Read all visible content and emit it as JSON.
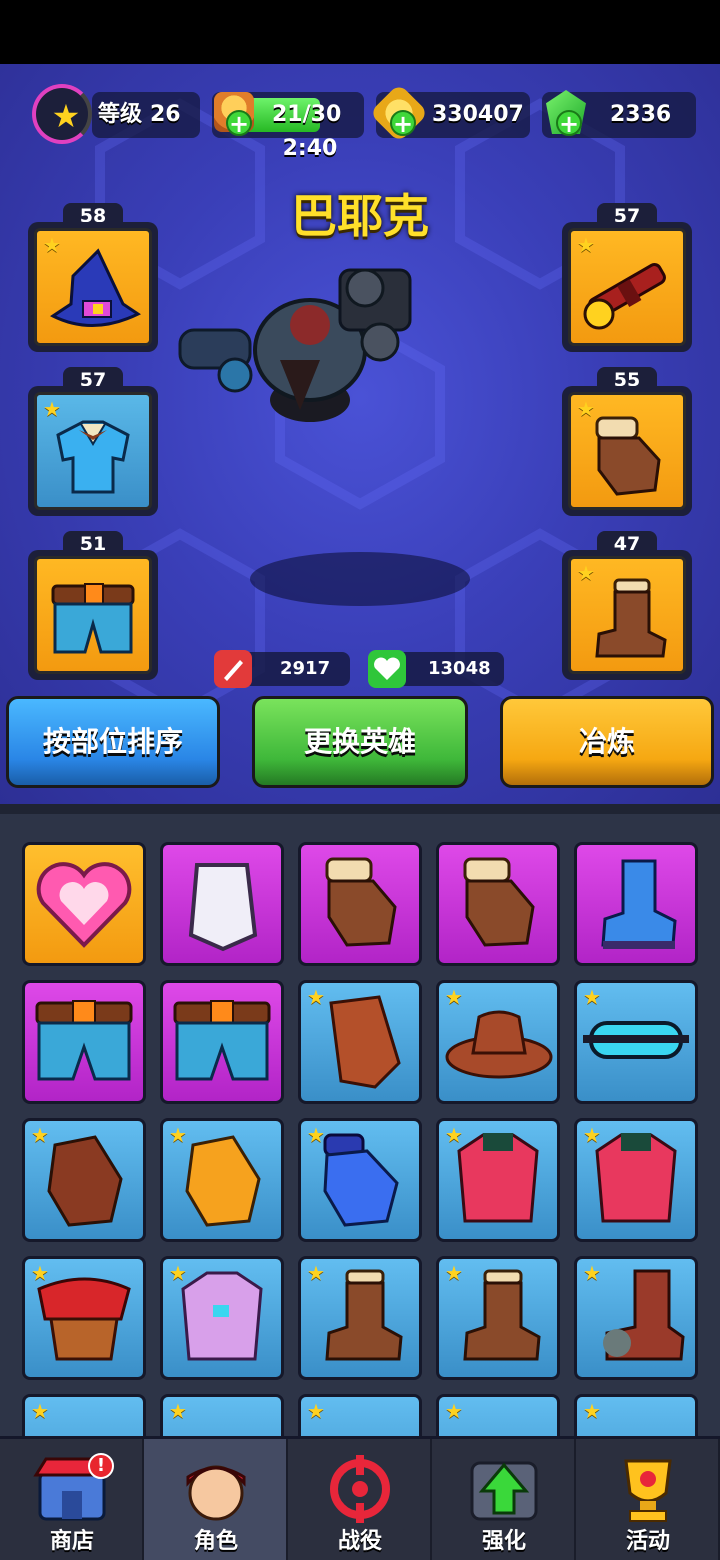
{
  "level": {
    "label": "等级",
    "value": "26"
  },
  "energy": {
    "value": "21/30",
    "timer": "2:40"
  },
  "coins": {
    "value": "330407"
  },
  "gems": {
    "value": "2336"
  },
  "hero": {
    "name": "巴耶克"
  },
  "equipped": {
    "left": [
      {
        "level": "58",
        "item": "witch-hat-icon"
      },
      {
        "level": "57",
        "item": "blue-shirt-icon"
      },
      {
        "level": "51",
        "item": "belt-shorts-icon"
      }
    ],
    "right": [
      {
        "level": "57",
        "item": "rocket-launcher-icon"
      },
      {
        "level": "55",
        "item": "glove-icon"
      },
      {
        "level": "47",
        "item": "boot-icon"
      }
    ]
  },
  "stats": {
    "attack": "2917",
    "health": "13048"
  },
  "buttons": {
    "sort": "按部位排序",
    "change_hero": "更换英雄",
    "smelt": "冶炼"
  },
  "inventory": {
    "rows": [
      [
        "heart-gold",
        "chestplate-purple",
        "glove-purple",
        "glove-purple",
        "boot-purple"
      ],
      [
        "shorts-purple",
        "shorts-purple",
        "vest-blue",
        "cowboy-hat-blue",
        "goggles-blue"
      ],
      [
        "glove-blue",
        "glove-orange-blue",
        "glove-blue-blue",
        "pink-jacket-blue",
        "pink-jacket-blue"
      ],
      [
        "scarf-blue",
        "purple-jacket-blue",
        "boot-blue",
        "boot-blue",
        "boot-red-blue"
      ]
    ]
  },
  "nav": [
    {
      "label": "商店",
      "icon": "shop-icon",
      "alert": "!"
    },
    {
      "label": "角色",
      "icon": "character-icon"
    },
    {
      "label": "战役",
      "icon": "crosshair-icon"
    },
    {
      "label": "强化",
      "icon": "upgrade-icon"
    },
    {
      "label": "活动",
      "icon": "trophy-icon"
    }
  ]
}
